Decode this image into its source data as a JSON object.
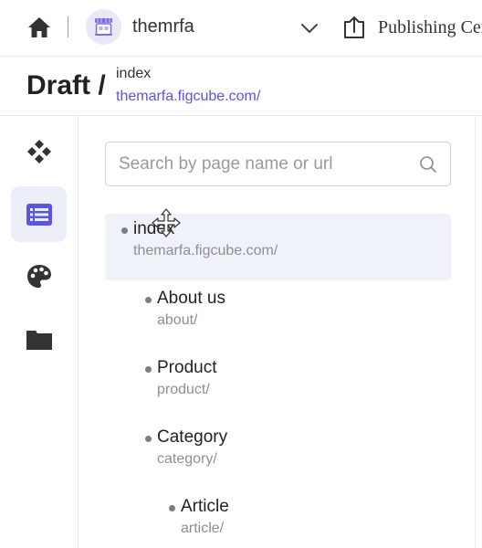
{
  "topbar": {
    "site_name": "themrfa",
    "publish_label": "Publishing Cen"
  },
  "draft": {
    "title": "Draft /",
    "page_name": "index",
    "page_url": "themarfa.figcube.com/"
  },
  "rail": {
    "items": [
      {
        "icon": "components-icon",
        "active": false
      },
      {
        "icon": "pages-list-icon",
        "active": true
      },
      {
        "icon": "palette-icon",
        "active": false
      },
      {
        "icon": "folder-icon",
        "active": false
      }
    ]
  },
  "search": {
    "placeholder": "Search by page name or url",
    "value": ""
  },
  "pages": [
    {
      "name": "index",
      "path": "themarfa.figcube.com/",
      "level": 0,
      "selected": true
    },
    {
      "name": "About us",
      "path": "about/",
      "level": 1,
      "selected": false
    },
    {
      "name": "Product",
      "path": "product/",
      "level": 1,
      "selected": false
    },
    {
      "name": "Category",
      "path": "category/",
      "level": 1,
      "selected": false
    },
    {
      "name": "Article",
      "path": "article/",
      "level": 2,
      "selected": false
    }
  ],
  "colors": {
    "accent": "#5b55e0",
    "active_rail_bg": "#eceef9",
    "selected_row_bg": "#f0f2fa"
  }
}
